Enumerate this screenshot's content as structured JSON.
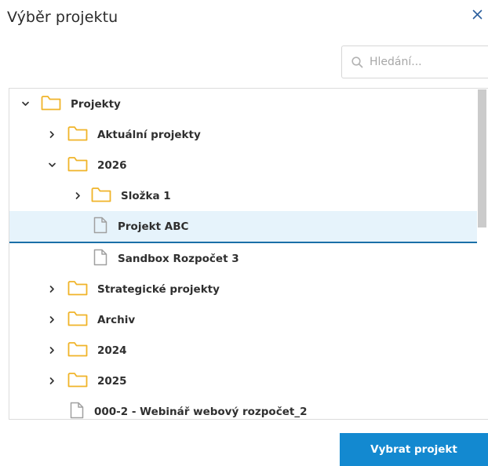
{
  "dialog": {
    "title": "Výběr projektu",
    "close_icon": "close-icon"
  },
  "search": {
    "placeholder": "Hledání...",
    "value": "",
    "icon": "search-icon"
  },
  "tree": {
    "items": [
      {
        "label": "Projekty",
        "type": "folder",
        "expanded": true,
        "level": 0
      },
      {
        "label": "Aktuální projekty",
        "type": "folder",
        "expanded": false,
        "level": 1
      },
      {
        "label": "2026",
        "type": "folder",
        "expanded": true,
        "level": 1
      },
      {
        "label": "Složka 1",
        "type": "folder",
        "expanded": false,
        "level": 2
      },
      {
        "label": "Projekt ABC",
        "type": "document",
        "selected": true,
        "level": 2
      },
      {
        "label": "Sandbox Rozpočet 3",
        "type": "document",
        "level": 2
      },
      {
        "label": "Strategické projekty",
        "type": "folder",
        "expanded": false,
        "level": 1
      },
      {
        "label": "Archiv",
        "type": "folder",
        "expanded": false,
        "level": 1
      },
      {
        "label": "2024",
        "type": "folder",
        "expanded": false,
        "level": 1
      },
      {
        "label": "2025",
        "type": "folder",
        "expanded": false,
        "level": 1
      },
      {
        "label": "000-2 - Webinář webový rozpočet_2",
        "type": "document",
        "level": 1
      }
    ]
  },
  "footer": {
    "select_label": "Vybrat projekt"
  },
  "colors": {
    "accent": "#1389d0",
    "folder": "#f0b429",
    "selected_bg": "#e6f3fb",
    "selected_line": "#1a6fa8"
  }
}
